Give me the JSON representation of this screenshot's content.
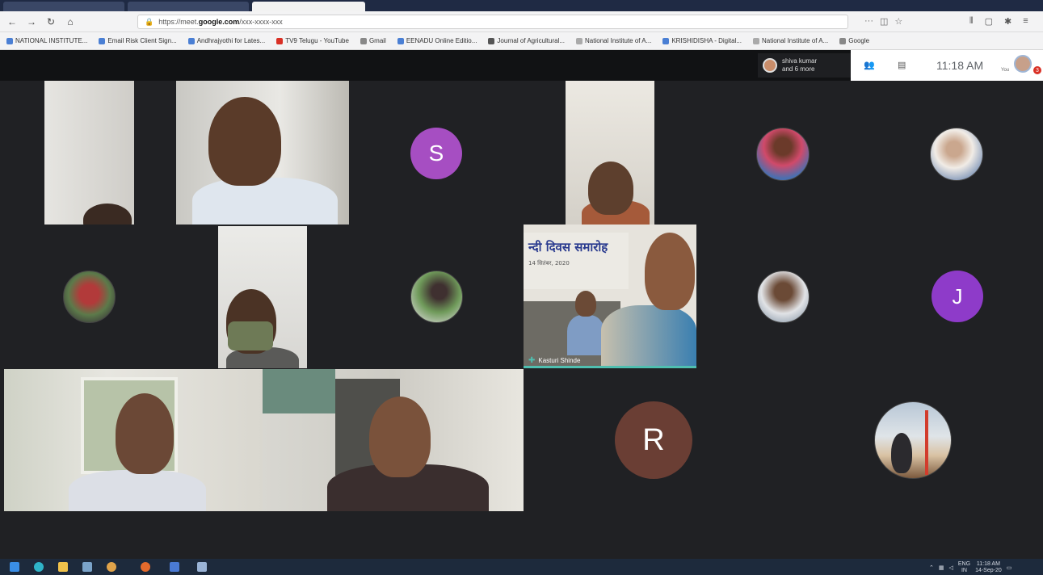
{
  "browser": {
    "url_prefix": "https://meet.",
    "url_domain": "google.com",
    "url_path": "/xxx-xxxx-xxx",
    "bookmarks": [
      "NATIONAL INSTITUTE...",
      "Email Risk Client Sign...",
      "Andhrajyothi for Lates...",
      "TV9 Telugu - YouTube",
      "Gmail",
      "EENADU Online Editio...",
      "Journal of Agricultural...",
      "National Institute of A...",
      "KRISHIDISHA - Digital...",
      "National Institute of A...",
      "Google"
    ]
  },
  "meet": {
    "participants_chip_line1": "shiva kumar",
    "participants_chip_line2": "and 6 more",
    "clock": "11:18 AM",
    "you_label": "You",
    "notification_count": "3",
    "tiles": {
      "letter_s": "S",
      "letter_j": "J",
      "letter_r": "R",
      "presenter_name": "Kasturi Shinde",
      "banner_heading": "न्दी दिवस समारोह",
      "banner_sub": "14 सितंबर, 2020"
    }
  },
  "taskbar": {
    "lang_top": "ENG",
    "lang_bottom": "IN",
    "time": "11:18 AM",
    "date": "14-Sep-20"
  },
  "colors": {
    "meet_bg": "#202124",
    "avatar_s": "#a64ec2",
    "avatar_j": "#8e3bc9",
    "avatar_r": "#6a3e34",
    "speaker_accent": "#4fbfb0"
  }
}
